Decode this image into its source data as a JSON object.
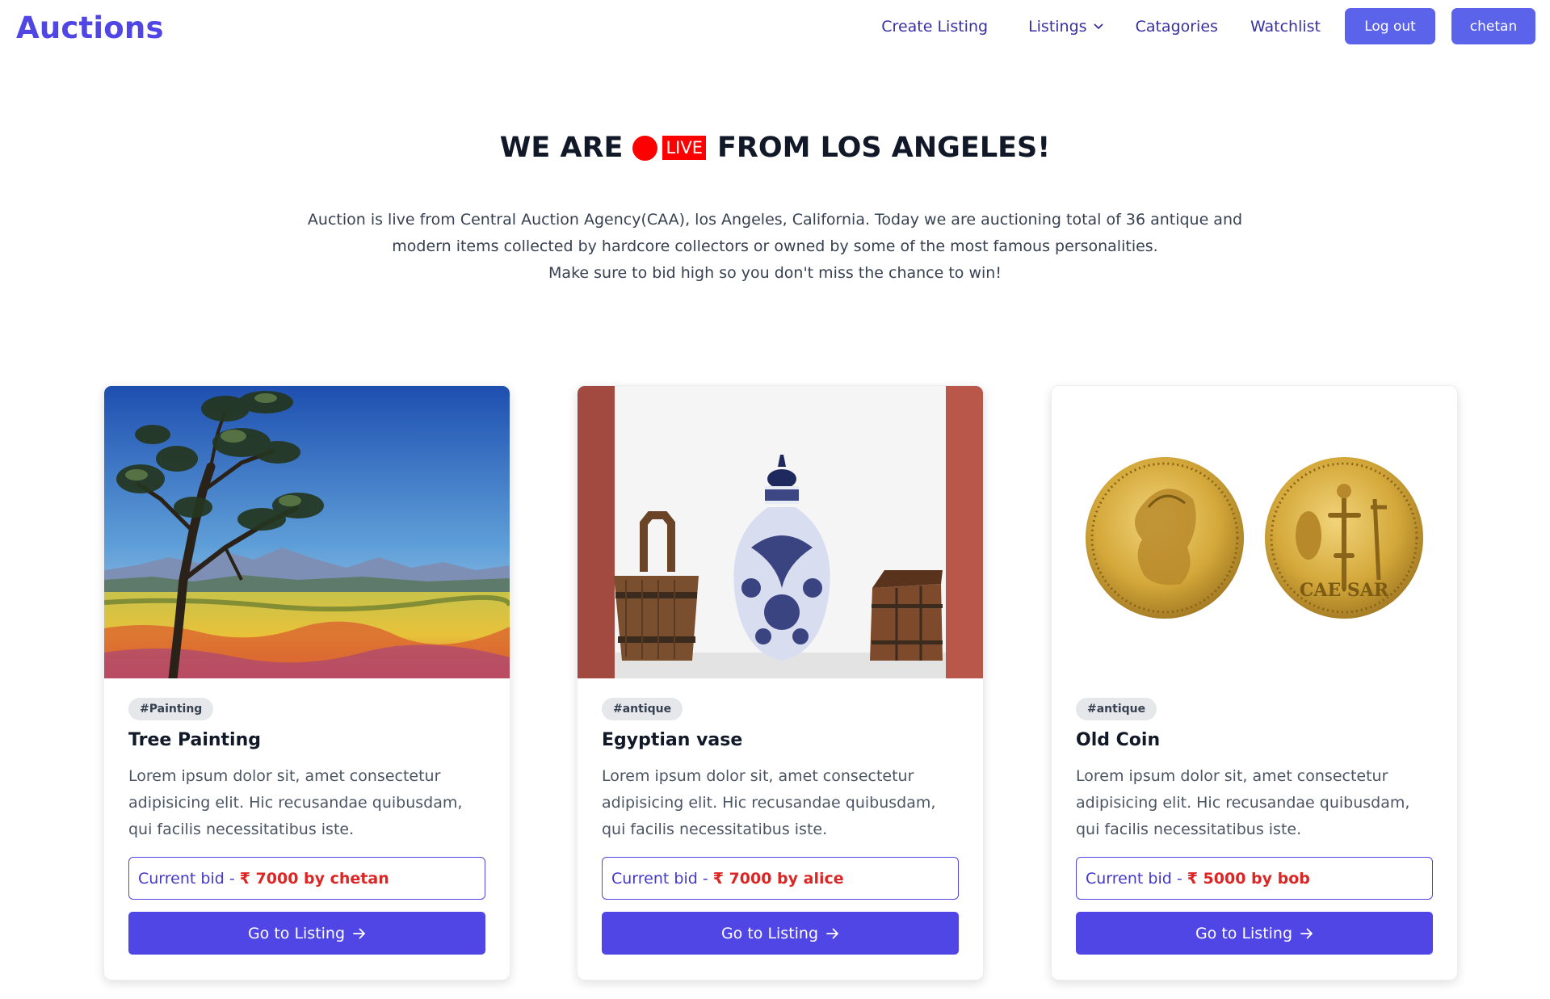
{
  "nav": {
    "brand": "Auctions",
    "links": {
      "create": "Create Listing",
      "listings": "Listings",
      "categories": "Catagories",
      "watchlist": "Watchlist"
    },
    "logout_label": "Log out",
    "user_label": "chetan"
  },
  "hero": {
    "title_before": "WE ARE",
    "live_badge": "LIVE",
    "title_after": "FROM LOS ANGELES!",
    "desc_line1": "Auction is live from Central Auction Agency(CAA), los Angeles, California. Today we are auctioning total of 36 antique and",
    "desc_line2": "modern items collected by hardcore collectors or owned by some of the most famous personalities.",
    "desc_line3": "Make sure to bid high so you don't miss the chance to win!"
  },
  "cards": [
    {
      "tag": "#Painting",
      "title": "Tree Painting",
      "desc": "Lorem ipsum dolor sit, amet consectetur adipisicing elit. Hic recusandae quibusdam, qui facilis necessitatibus iste.",
      "bid_label": "Current bid -",
      "bid_value": "₹ 7000 by chetan",
      "button": "Go to Listing"
    },
    {
      "tag": "#antique",
      "title": "Egyptian vase",
      "desc": "Lorem ipsum dolor sit, amet consectetur adipisicing elit. Hic recusandae quibusdam, qui facilis necessitatibus iste.",
      "bid_label": "Current bid -",
      "bid_value": "₹ 7000 by alice",
      "button": "Go to Listing"
    },
    {
      "tag": "#antique",
      "title": "Old Coin",
      "desc": "Lorem ipsum dolor sit, amet consectetur adipisicing elit. Hic recusandae quibusdam, qui facilis necessitatibus iste.",
      "bid_label": "Current bid -",
      "bid_value": "₹ 5000 by bob",
      "button": "Go to Listing"
    }
  ],
  "icons": {
    "listings_dropdown": "chevron-down-icon",
    "go_button": "arrow-right-icon",
    "live": "live-dot-icon"
  },
  "colors": {
    "brand": "#4f46e5",
    "live": "#ff0000",
    "bid_value": "#dc2626"
  }
}
